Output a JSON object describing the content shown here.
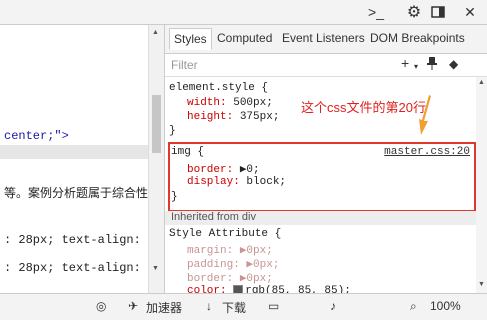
{
  "topbar": {
    "icons": [
      "terminal-icon",
      "gear-icon",
      "dock-icon",
      "close-icon"
    ]
  },
  "left": {
    "lines": [
      {
        "text": " center;\">"
      },
      {
        "text": "等。案例分析题属于综合性"
      },
      {
        "text": ": 28px; text-align:"
      },
      {
        "text": ": 28px; text-align:"
      }
    ]
  },
  "tabs": {
    "items": [
      "Styles",
      "Computed",
      "Event Listeners",
      "DOM Breakpoints"
    ]
  },
  "filter": {
    "placeholder": "Filter",
    "add": "+",
    "pin": "📌",
    "more": "◆"
  },
  "element_style": {
    "selector": "element.style {",
    "props": [
      {
        "name": "width",
        "value": "500px;"
      },
      {
        "name": "height",
        "value": "375px;"
      }
    ],
    "close": "}"
  },
  "annotation": "这个css文件的第20行",
  "img_rule": {
    "selector": "img {",
    "source": "master.css:20",
    "props": [
      {
        "name": "border",
        "value": "▶0;"
      },
      {
        "name": "display",
        "value": "block;"
      }
    ],
    "close": "}"
  },
  "inherited": "Inherited from div",
  "style_attr": {
    "selector": "Style Attribute {",
    "props": [
      {
        "name": "margin",
        "value": "▶0px;"
      },
      {
        "name": "padding",
        "value": "▶0px;"
      },
      {
        "name": "border",
        "value": "▶0px;"
      },
      {
        "name": "color",
        "value": "rgb(85, 85, 85);"
      }
    ]
  },
  "status": {
    "download_accel": "加速器",
    "download": "下载",
    "zoom": "100%"
  },
  "colors": {
    "highlight_border": "#e0392b",
    "annotation": "#e02020",
    "property": "#c80000"
  }
}
